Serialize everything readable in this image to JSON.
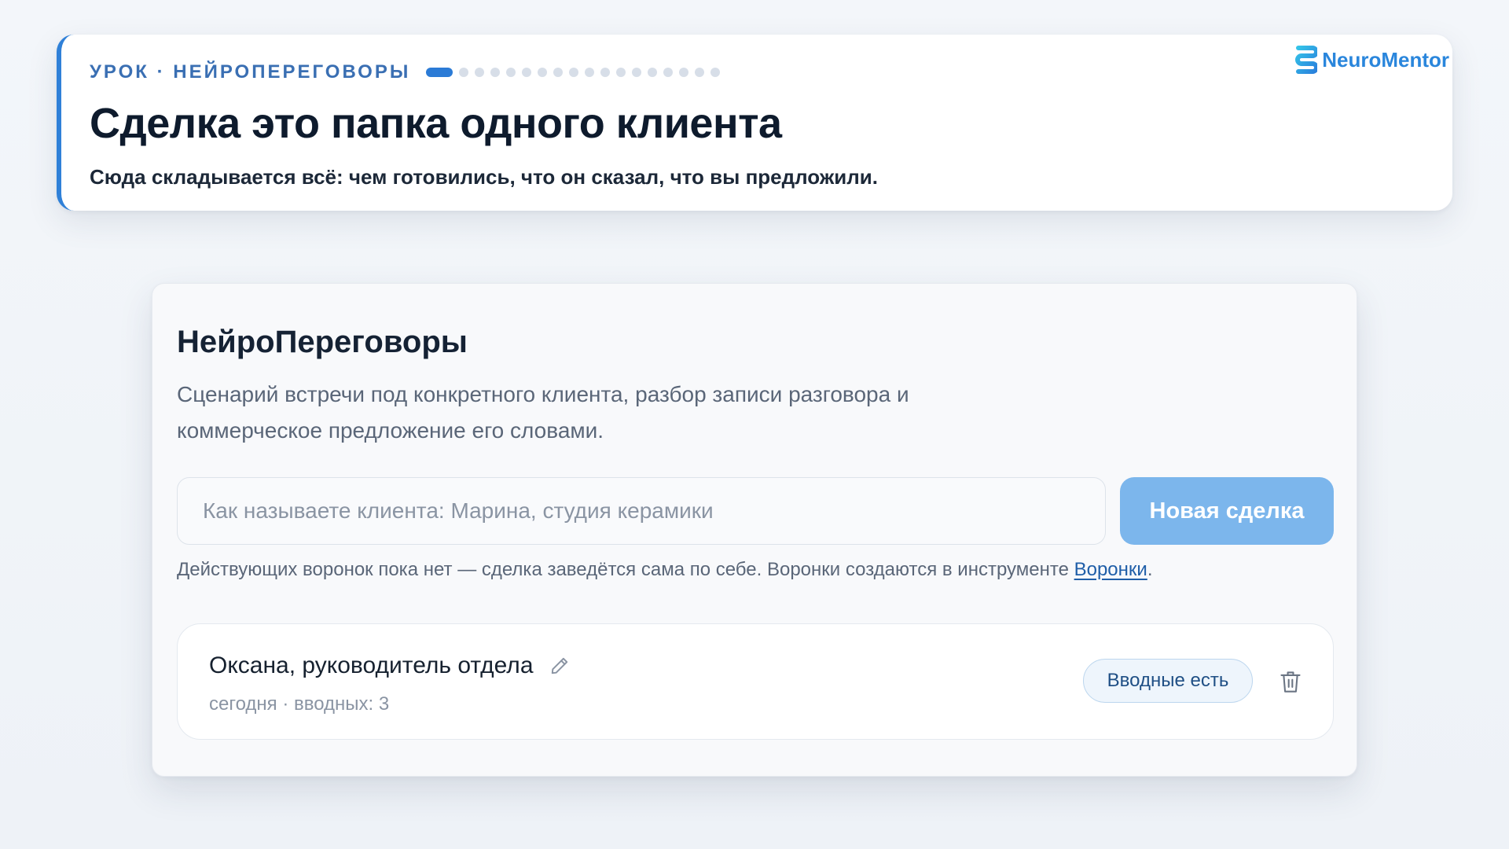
{
  "lesson": {
    "kicker": "УРОК · НЕЙРОПЕРЕГОВОРЫ",
    "title": "Сделка это папка одного клиента",
    "subtitle": "Сюда складывается всё: чем готовились, что он сказал, что вы предложили.",
    "progress": {
      "total": 18,
      "current": 1
    }
  },
  "brand": {
    "name": "NeuroMentor",
    "icon": "brand-logo-icon",
    "color": "#2a86dc"
  },
  "tool": {
    "title": "НейроПереговоры",
    "description": "Сценарий встречи под конкретного клиента, разбор записи разговора и коммерческое предложение его словами.",
    "input": {
      "placeholder": "Как называете клиента: Марина, студия керамики",
      "value": ""
    },
    "new_deal_label": "Новая сделка",
    "hint_text": "Действующих воронок пока нет — сделка заведётся сама по себе. Воронки создаются в инструменте ",
    "hint_link": "Воронки",
    "hint_end": "."
  },
  "deals": [
    {
      "name": "Оксана, руководитель отдела",
      "meta": "сегодня · вводных: 3",
      "status": "Вводные есть",
      "edit_icon": "pencil-icon",
      "delete_icon": "trash-icon"
    }
  ],
  "colors": {
    "accent": "#2b7bd6",
    "button": "#7cb6ec",
    "link": "#1f5ea8"
  }
}
